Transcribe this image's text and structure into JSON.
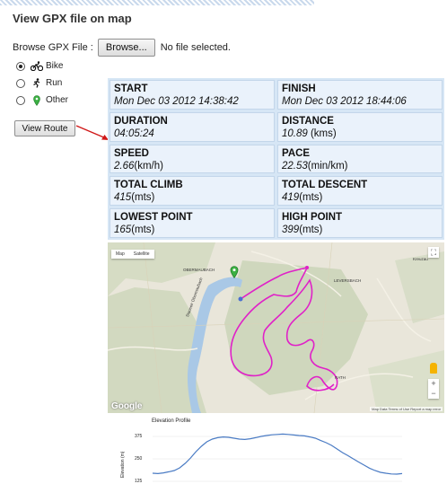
{
  "page": {
    "title": "View GPX file on map"
  },
  "file": {
    "label": "Browse GPX File :",
    "button": "Browse...",
    "status": "No file selected."
  },
  "modes": [
    {
      "label": "Bike",
      "selected": true,
      "icon": "bike-icon"
    },
    {
      "label": "Run",
      "selected": false,
      "icon": "runner-icon"
    },
    {
      "label": "Other",
      "selected": false,
      "icon": "map-pin-icon"
    }
  ],
  "view_button": "View Route",
  "stats": {
    "start": {
      "label": "START",
      "value": "Mon Dec 03 2012 14:38:42"
    },
    "finish": {
      "label": "FINISH",
      "value": "Mon Dec 03 2012 18:44:06"
    },
    "duration": {
      "label": "DURATION",
      "value": "04:05:24"
    },
    "distance": {
      "label": "DISTANCE",
      "value": "10.89",
      "unit": " (kms)"
    },
    "speed": {
      "label": "SPEED",
      "value": "2.66",
      "unit": "(km/h)"
    },
    "pace": {
      "label": "PACE",
      "value": "22.53",
      "unit": "(min/km)"
    },
    "climb": {
      "label": "TOTAL CLIMB",
      "value": "415",
      "unit": "(mts)"
    },
    "descent": {
      "label": "TOTAL DESCENT",
      "value": "419",
      "unit": "(mts)"
    },
    "lowest": {
      "label": "LOWEST POINT",
      "value": "165",
      "unit": "(mts)"
    },
    "highest": {
      "label": "HIGH POINT",
      "value": "399",
      "unit": "(mts)"
    }
  },
  "map": {
    "type_map": "Map",
    "type_satellite": "Satellite",
    "brand": "Google",
    "footer": "Map Data   Terms of Use   Report a map error",
    "places": [
      "OBERMAUBACH",
      "LEVERSBACH",
      "RATH",
      "Kreuzau",
      "Stausee Obermaubach"
    ],
    "route_color": "#e020c8"
  },
  "elevation": {
    "title": "Elevation Profile",
    "ylabel": "Elevation (m)",
    "yticks": [
      "375",
      "250",
      "125"
    ],
    "ylim": [
      125,
      425
    ],
    "line_color": "#4a7bc4",
    "values": [
      170,
      168,
      172,
      178,
      185,
      200,
      225,
      255,
      290,
      320,
      345,
      360,
      368,
      372,
      370,
      365,
      360,
      358,
      362,
      368,
      375,
      380,
      384,
      386,
      388,
      386,
      383,
      380,
      378,
      372,
      365,
      352,
      340,
      325,
      305,
      285,
      268,
      250,
      232,
      215,
      198,
      185,
      175,
      170,
      166,
      165,
      168
    ]
  }
}
